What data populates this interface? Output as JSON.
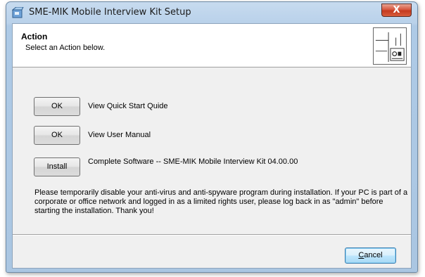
{
  "window": {
    "title": "SME-MIK Mobile Interview Kit Setup",
    "close_label": "X"
  },
  "header": {
    "title": "Action",
    "subtitle": "Select an Action below."
  },
  "actions": [
    {
      "button": "OK",
      "label": "View Quick Start Quide"
    },
    {
      "button": "OK",
      "label": "View User Manual"
    },
    {
      "button": "Install",
      "label": "Complete   Software -- SME-MIK Mobile Interview Kit 04.00.00"
    }
  ],
  "notice": "Please temporarily disable your anti-virus and anti-spyware program during installation. If your PC is part of a corporate or office network and logged in as a limited rights user, please log back in as \"admin\" before starting the installation. Thank you!",
  "footer": {
    "cancel_first": "C",
    "cancel_rest": "ancel"
  },
  "colors": {
    "close_red": "#c53a1f",
    "titlebar_blue": "#b9d1ea",
    "client_gray": "#f0f0f0",
    "default_button_border": "#3c7fb1"
  },
  "icons": {
    "app": "setup-box-icon",
    "header_logo": "installer-logo-icon"
  }
}
